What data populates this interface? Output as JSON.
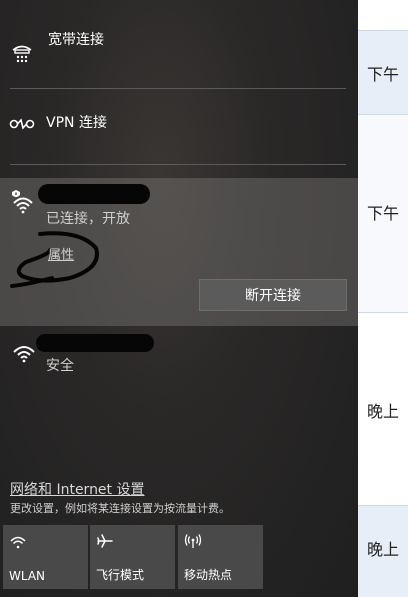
{
  "panel": {
    "broadband": {
      "label": "宽带连接",
      "icon": "dialup-icon"
    },
    "vpn": {
      "label": "VPN 连接",
      "icon": "vpn-icon"
    },
    "wifi_connected": {
      "status": "已连接，开放",
      "properties_link": "属性",
      "disconnect_button": "断开连接",
      "icon": "wifi-shield-icon"
    },
    "wifi_other": {
      "status": "安全",
      "icon": "wifi-icon"
    },
    "settings_link": "网络和 Internet 设置",
    "settings_description": "更改设置，例如将某连接设置为按流量计费。",
    "quick_actions": [
      {
        "label": "WLAN",
        "icon": "wifi-icon"
      },
      {
        "label": "飞行模式",
        "icon": "airplane-icon"
      },
      {
        "label": "移动热点",
        "icon": "hotspot-icon"
      }
    ]
  },
  "background_strip": {
    "cells": [
      "下午",
      "下午",
      "晚上",
      "晚上"
    ]
  }
}
